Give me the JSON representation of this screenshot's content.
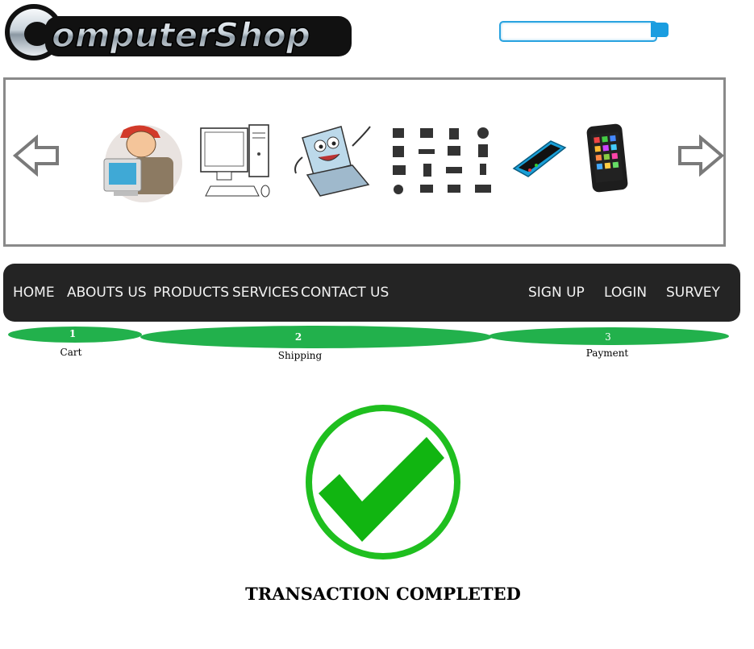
{
  "brand": {
    "logo_text": "ComputerShop"
  },
  "search": {
    "value": "",
    "placeholder": ""
  },
  "carousel": {
    "items": [
      {
        "name": "technician-computer-image"
      },
      {
        "name": "desktop-computer-image"
      },
      {
        "name": "laptop-cartoon-image"
      },
      {
        "name": "hardware-icons-image"
      },
      {
        "name": "smartphone-image"
      },
      {
        "name": "tablet-phone-image"
      }
    ]
  },
  "nav": {
    "items": [
      {
        "label": "HOME"
      },
      {
        "label": "ABOUTS US"
      },
      {
        "label": "PRODUCTS"
      },
      {
        "label": "SERVICES"
      },
      {
        "label": "CONTACT US"
      }
    ],
    "right": [
      {
        "label": "SIGN UP"
      },
      {
        "label": "LOGIN"
      },
      {
        "label": "SURVEY"
      }
    ]
  },
  "steps": [
    {
      "number": "1",
      "label": "Cart"
    },
    {
      "number": "2",
      "label": "Shipping"
    },
    {
      "number": "3",
      "label": "Payment"
    }
  ],
  "status": {
    "message": "TRANSACTION COMPLETED"
  },
  "colors": {
    "nav_bg": "#242424",
    "step_green": "#22b14c",
    "check_green": "#1fbf1f",
    "search_accent": "#1a9de0"
  }
}
